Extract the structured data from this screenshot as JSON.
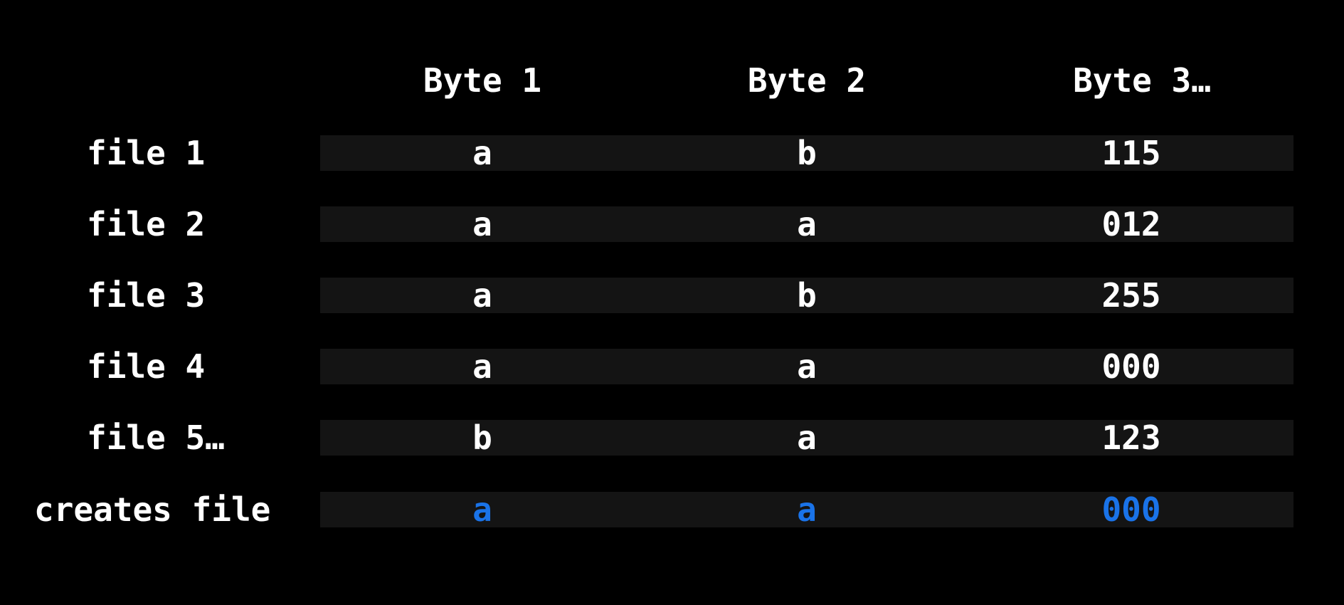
{
  "accent_color": "#1a73e8",
  "text_color": "#ffffff",
  "band_color": "#141414",
  "background_color": "#000000",
  "headers": [
    "Byte 1",
    "Byte 2",
    "Byte 3…"
  ],
  "rows": [
    {
      "label": "file 1",
      "cells": [
        "a",
        "b",
        "115"
      ]
    },
    {
      "label": "file 2",
      "cells": [
        "a",
        "a",
        "012"
      ]
    },
    {
      "label": "file 3",
      "cells": [
        "a",
        "b",
        "255"
      ]
    },
    {
      "label": "file 4",
      "cells": [
        "a",
        "a",
        "000"
      ]
    },
    {
      "label": "file 5…",
      "cells": [
        "b",
        "a",
        "123"
      ]
    }
  ],
  "result": {
    "label": "creates file",
    "cells": [
      "a",
      "a",
      "000"
    ]
  }
}
